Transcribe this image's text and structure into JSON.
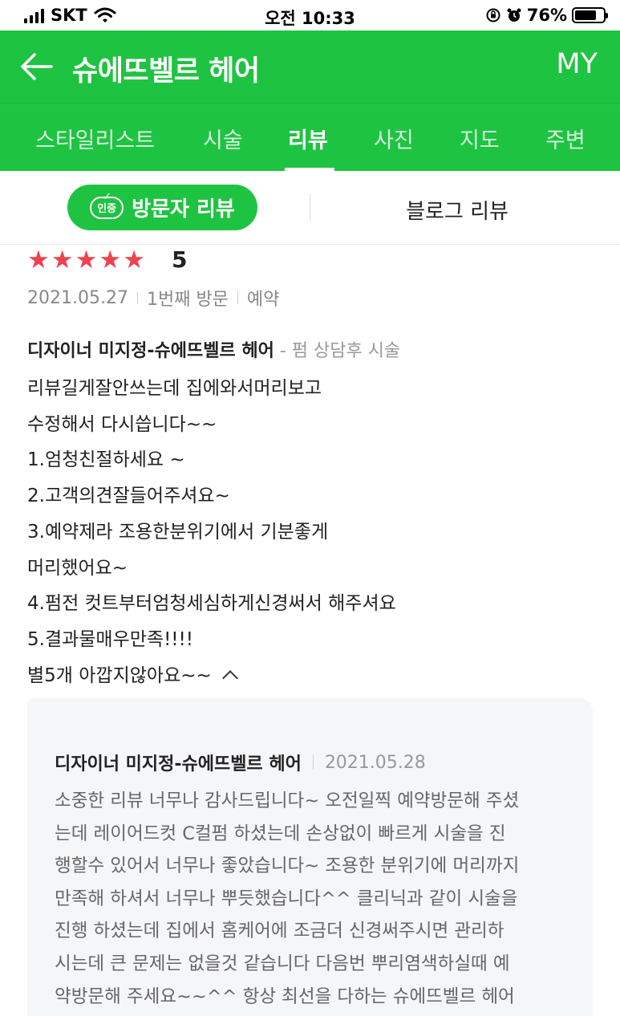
{
  "status_bar": {
    "carrier": "SKT",
    "time": "오전 10:33",
    "battery": "76%",
    "battery_level": 0.76
  },
  "header": {
    "back_icon": "arrow-left-icon",
    "title": "슈에뜨벨르 헤어",
    "my": "MY"
  },
  "tabs": [
    {
      "label": "스타일리스트",
      "active": false
    },
    {
      "label": "시술",
      "active": false
    },
    {
      "label": "리뷰",
      "active": true
    },
    {
      "label": "사진",
      "active": false
    },
    {
      "label": "지도",
      "active": false
    },
    {
      "label": "주변",
      "active": false
    }
  ],
  "review_type": {
    "badge": "인증",
    "visitor": "방문자 리뷰",
    "blog": "블로그 리뷰"
  },
  "review": {
    "stars": 5,
    "rating": "5",
    "date": "2021.05.27",
    "visit": "1번째 방문",
    "booking": "예약",
    "designer": "디자이너 미지정-슈에뜨벨르 헤어",
    "dash": " - ",
    "service": "펌 상담후 시술",
    "lines": [
      "리뷰길게잘안쓰는데 집에와서머리보고",
      "수정해서 다시씁니다~~",
      "1.엄청친절하세요 ~",
      "2.고객의견잘들어주셔요~",
      "3.예약제라 조용한분위기에서 기분좋게",
      "머리했어요~",
      "4.펌전 컷트부터엄청세심하게신경써서 해주셔요",
      "5.결과물매우만족!!!!",
      "별5개 아깝지않아요~~"
    ]
  },
  "reply": {
    "name": "디자이너 미지정-슈에뜨벨르 헤어",
    "date": "2021.05.28",
    "lines": [
      "소중한 리뷰 너무나 감사드립니다~ 오전일찍 예약방문해 주셨",
      "는데 레이어드컷 C컬펌 하셨는데 손상없이 빠르게 시술을 진",
      "행할수 있어서 너무나 좋았습니다~ 조용한 분위기에 머리까지",
      "만족해 하셔서 너무나 뿌듯했습니다^^ 클리닉과 같이 시술을",
      "진행 하셨는데 집에서 홈케어에 조금더 신경써주시면 관리하",
      "시는데 큰 문제는 없을것 같습니다 다음번 뿌리염색하실때 예",
      "약방문해 주세요~~^^ 항상 최선을 다하는 슈에뜨벨르 헤어"
    ]
  },
  "colors": {
    "brand_green": "#1fc342",
    "star_red": "#f0424d"
  }
}
